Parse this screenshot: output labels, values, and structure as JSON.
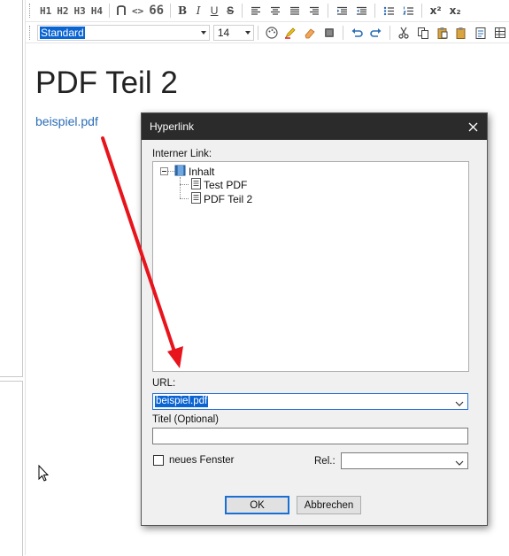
{
  "toolbar1": {
    "h1": "H1",
    "h2": "H2",
    "h3": "H3",
    "h4": "H4",
    "code": "<>",
    "quote": "66",
    "bold": "B",
    "italic": "I",
    "underline": "U",
    "strike": "S",
    "superscript": "x²",
    "subscript": "x₂"
  },
  "toolbar2": {
    "style_value": "Standard",
    "font_size": "14"
  },
  "document": {
    "heading": "PDF Teil 2",
    "link_text": "beispiel.pdf"
  },
  "dialog": {
    "title": "Hyperlink",
    "internal_link_label": "Interner Link:",
    "tree": {
      "root": "Inhalt",
      "children": [
        "Test PDF",
        "PDF Teil 2"
      ]
    },
    "url_label": "URL:",
    "url_value": "beispiel.pdf",
    "title_label": "Titel (Optional)",
    "title_value": "",
    "new_window_label": "neues Fenster",
    "new_window_checked": false,
    "rel_label": "Rel.:",
    "rel_value": "",
    "ok_label": "OK",
    "cancel_label": "Abbrechen"
  },
  "colors": {
    "selection": "#0a64d2",
    "link": "#2a6db5",
    "annotation_arrow": "#e8141c",
    "dialog_titlebar": "#2b2b2b"
  }
}
